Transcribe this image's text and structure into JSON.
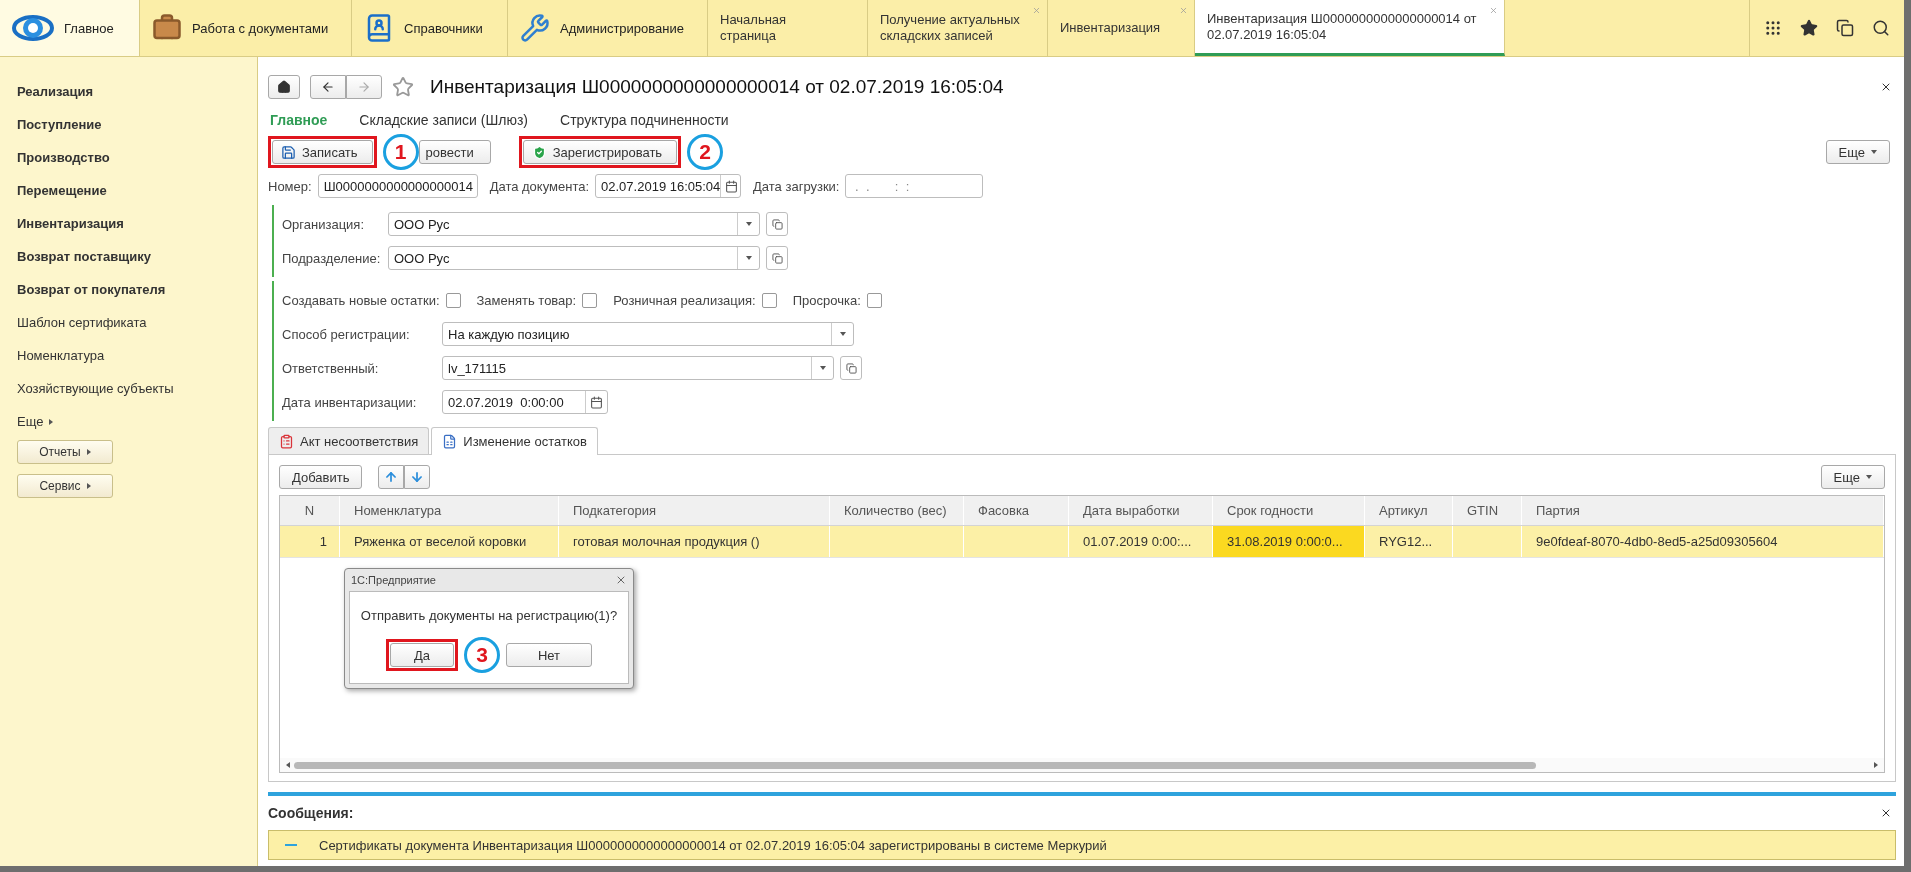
{
  "top_bar": {
    "sections": [
      {
        "label": "Главное",
        "selected": true
      },
      {
        "label": "Работа с документами",
        "selected": false
      },
      {
        "label": "Справочники",
        "selected": false
      },
      {
        "label": "Администрирование",
        "selected": false
      }
    ],
    "open_tabs": [
      {
        "label": "Начальная страница",
        "closable": false,
        "selected": false
      },
      {
        "label": "Получение актуальных складских записей",
        "closable": true,
        "selected": false
      },
      {
        "label": "Инвентаризация",
        "closable": true,
        "selected": false
      },
      {
        "label": "Инвентаризация Ш0000000000000000014 от 02.07.2019 16:05:04",
        "closable": true,
        "selected": true
      }
    ]
  },
  "sidebar": {
    "items": [
      {
        "label": "Реализация",
        "kind": "bold"
      },
      {
        "label": "Поступление",
        "kind": "bold"
      },
      {
        "label": "Производство",
        "kind": "bold"
      },
      {
        "label": "Перемещение",
        "kind": "bold"
      },
      {
        "label": "Инвентаризация",
        "kind": "bold"
      },
      {
        "label": "Возврат поставщику",
        "kind": "bold"
      },
      {
        "label": "Возврат от покупателя",
        "kind": "bold"
      },
      {
        "label": "Шаблон сертификата",
        "kind": "link"
      },
      {
        "label": "Номенклатура",
        "kind": "link"
      },
      {
        "label": "Хозяйствующие субъекты",
        "kind": "link"
      },
      {
        "label": "Еще",
        "kind": "more"
      },
      {
        "label": "Отчеты",
        "kind": "button"
      },
      {
        "label": "Сервис",
        "kind": "button"
      }
    ]
  },
  "form": {
    "title": "Инвентаризация Ш0000000000000000014 от 02.07.2019 16:05:04",
    "nav": [
      {
        "label": "Главное",
        "selected": true
      },
      {
        "label": "Складские записи (Шлюз)",
        "selected": false
      },
      {
        "label": "Структура подчиненности",
        "selected": false
      }
    ],
    "toolbar": [
      {
        "label": "Записать",
        "highlighted": true,
        "callout": "1"
      },
      {
        "label": "ровести",
        "highlighted": false
      },
      {
        "label": "Зарегистрировать",
        "highlighted": true,
        "callout": "2"
      }
    ],
    "more_button": "Еще",
    "header_fields": [
      {
        "label": "Номер:",
        "value": "Ш0000000000000000014",
        "kind": "text"
      },
      {
        "label": "Дата документа:",
        "value": "02.07.2019 16:05:04",
        "kind": "date"
      },
      {
        "label": "Дата загрузки:",
        "placeholder": " .  .       :  :",
        "kind": "mask"
      }
    ],
    "org_fields": [
      {
        "label": "Организация:",
        "value": "ООО Рус"
      },
      {
        "label": "Подразделение:",
        "value": "ООО Рус"
      }
    ],
    "checkboxes": [
      {
        "label": "Создавать новые остатки:",
        "checked": false
      },
      {
        "label": "Заменять товар:",
        "checked": false
      },
      {
        "label": "Розничная реализация:",
        "checked": false
      },
      {
        "label": "Просрочка:",
        "checked": false
      }
    ],
    "detail_fields": [
      {
        "label": "Способ регистрации:",
        "value": "На каждую позицию",
        "kind": "select"
      },
      {
        "label": "Ответственный:",
        "value": "lv_171115",
        "kind": "ref"
      },
      {
        "label": "Дата инвентаризации:",
        "value": "02.07.2019  0:00:00",
        "kind": "date"
      }
    ],
    "tabs": [
      {
        "label": "Акт несоответствия",
        "selected": false
      },
      {
        "label": "Изменение остатков",
        "selected": true
      }
    ],
    "table_toolbar": {
      "add": "Добавить",
      "more": "Еще"
    },
    "table": {
      "columns": [
        "N",
        "Номенклатура",
        "Подкатегория",
        "Количество (вес)",
        "Фасовка",
        "Дата выработки",
        "Срок годности",
        "Артикул",
        "GTIN",
        "Партия"
      ],
      "rows": [
        {
          "selected": true,
          "cells": [
            {
              "text": "1",
              "selected": false
            },
            {
              "text": "Ряженка от веселой коровки",
              "selected": false
            },
            {
              "text": "готовая молочная продукция ()",
              "selected": false
            },
            {
              "selected": false
            },
            {
              "selected": false
            },
            {
              "text": "01.07.2019 0:00:...",
              "selected": false
            },
            {
              "text": "31.08.2019 0:00:0...",
              "selected": true
            },
            {
              "text": "RYG12...",
              "selected": false
            },
            {
              "selected": false
            },
            {
              "text": "9e0fdeaf-8070-4db0-8ed5-a25d09305604",
              "selected": false
            }
          ]
        }
      ]
    },
    "dialog": {
      "title": "1С:Предприятие",
      "message": "Отправить документы на регистрацию(1)?",
      "buttons": [
        {
          "label": "Да",
          "highlighted": true,
          "callout": "3"
        },
        {
          "label": "Нет",
          "highlighted": false
        }
      ]
    }
  },
  "messages": {
    "title": "Сообщения:",
    "items": [
      "Сертификаты документа Инвентаризация Ш0000000000000000014 от 02.07.2019 16:05:04 зарегистрированы в системе Меркурий"
    ]
  }
}
